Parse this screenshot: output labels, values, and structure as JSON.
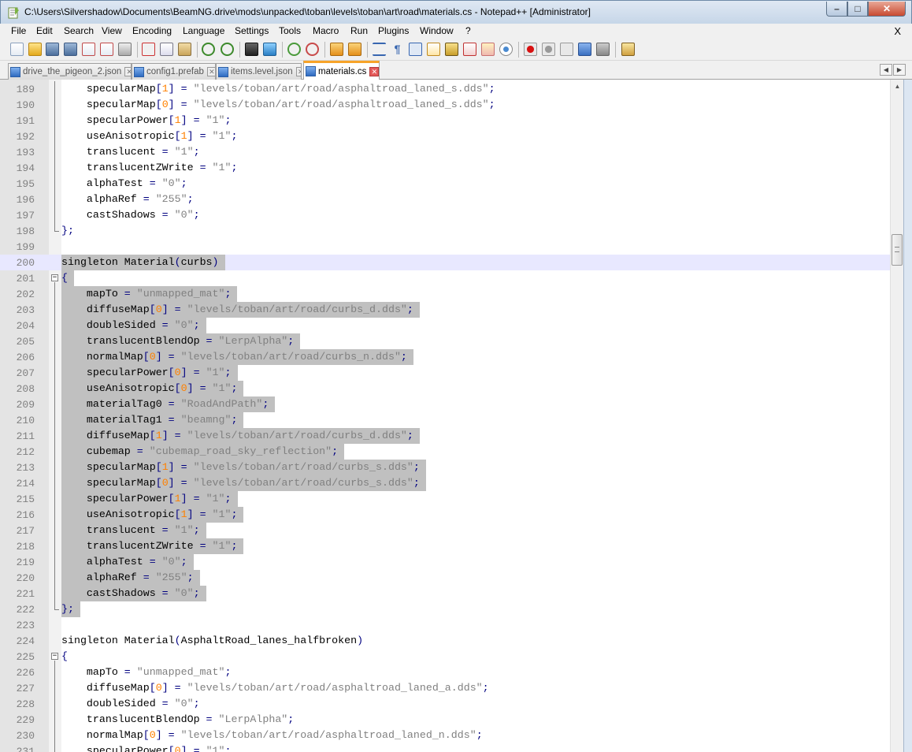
{
  "window": {
    "title": "C:\\Users\\Silvershadow\\Documents\\BeamNG.drive\\mods\\unpacked\\toban\\levels\\toban\\art\\road\\materials.cs - Notepad++ [Administrator]",
    "minimize": "–",
    "maximize": "□",
    "close": "✕"
  },
  "menu": {
    "items": [
      "File",
      "Edit",
      "Search",
      "View",
      "Encoding",
      "Language",
      "Settings",
      "Tools",
      "Macro",
      "Run",
      "Plugins",
      "Window",
      "?"
    ],
    "close_x": "X"
  },
  "toolbar": {
    "icons": [
      "new-file-icon",
      "open-file-icon",
      "save-icon",
      "save-all-icon",
      "close-icon",
      "close-all-icon",
      "print-icon",
      "cut-icon",
      "copy-icon",
      "paste-icon",
      "undo-icon",
      "redo-icon",
      "find-icon",
      "replace-icon",
      "zoom-in-icon",
      "zoom-out-icon",
      "sync-vertical-icon",
      "sync-horizontal-icon",
      "word-wrap-icon",
      "show-all-chars-icon",
      "indent-guide-icon",
      "user-language-icon",
      "doc-map-icon",
      "function-list-icon",
      "folder-as-workspace-icon",
      "monitoring-icon",
      "record-macro-icon",
      "stop-macro-icon",
      "play-macro-icon",
      "run-macro-multiple-icon",
      "save-macro-icon",
      "launch-browser-icon"
    ]
  },
  "tabs": [
    {
      "label": "drive_the_pigeon_2.json",
      "active": false
    },
    {
      "label": "config1.prefab",
      "active": false
    },
    {
      "label": "items.level.json",
      "active": false
    },
    {
      "label": "materials.cs",
      "active": true
    }
  ],
  "editor": {
    "current_line": 200,
    "selection_start": 201,
    "selection_end": 222,
    "lines": [
      {
        "n": "189",
        "text": "    specularMap[1] = \"levels/toban/art/road/asphaltroad_laned_s.dds\";"
      },
      {
        "n": "190",
        "text": "    specularMap[0] = \"levels/toban/art/road/asphaltroad_laned_s.dds\";"
      },
      {
        "n": "191",
        "text": "    specularPower[1] = \"1\";"
      },
      {
        "n": "192",
        "text": "    useAnisotropic[1] = \"1\";"
      },
      {
        "n": "193",
        "text": "    translucent = \"1\";"
      },
      {
        "n": "194",
        "text": "    translucentZWrite = \"1\";"
      },
      {
        "n": "195",
        "text": "    alphaTest = \"0\";"
      },
      {
        "n": "196",
        "text": "    alphaRef = \"255\";"
      },
      {
        "n": "197",
        "text": "    castShadows = \"0\";"
      },
      {
        "n": "198",
        "text": "};"
      },
      {
        "n": "199",
        "text": ""
      },
      {
        "n": "200",
        "text": "singleton Material(curbs)"
      },
      {
        "n": "201",
        "text": "{"
      },
      {
        "n": "202",
        "text": "    mapTo = \"unmapped_mat\";"
      },
      {
        "n": "203",
        "text": "    diffuseMap[0] = \"levels/toban/art/road/curbs_d.dds\";"
      },
      {
        "n": "204",
        "text": "    doubleSided = \"0\";"
      },
      {
        "n": "205",
        "text": "    translucentBlendOp = \"LerpAlpha\";"
      },
      {
        "n": "206",
        "text": "    normalMap[0] = \"levels/toban/art/road/curbs_n.dds\";"
      },
      {
        "n": "207",
        "text": "    specularPower[0] = \"1\";"
      },
      {
        "n": "208",
        "text": "    useAnisotropic[0] = \"1\";"
      },
      {
        "n": "209",
        "text": "    materialTag0 = \"RoadAndPath\";"
      },
      {
        "n": "210",
        "text": "    materialTag1 = \"beamng\";"
      },
      {
        "n": "211",
        "text": "    diffuseMap[1] = \"levels/toban/art/road/curbs_d.dds\";"
      },
      {
        "n": "212",
        "text": "    cubemap = \"cubemap_road_sky_reflection\";"
      },
      {
        "n": "213",
        "text": "    specularMap[1] = \"levels/toban/art/road/curbs_s.dds\";"
      },
      {
        "n": "214",
        "text": "    specularMap[0] = \"levels/toban/art/road/curbs_s.dds\";"
      },
      {
        "n": "215",
        "text": "    specularPower[1] = \"1\";"
      },
      {
        "n": "216",
        "text": "    useAnisotropic[1] = \"1\";"
      },
      {
        "n": "217",
        "text": "    translucent = \"1\";"
      },
      {
        "n": "218",
        "text": "    translucentZWrite = \"1\";"
      },
      {
        "n": "219",
        "text": "    alphaTest = \"0\";"
      },
      {
        "n": "220",
        "text": "    alphaRef = \"255\";"
      },
      {
        "n": "221",
        "text": "    castShadows = \"0\";"
      },
      {
        "n": "222",
        "text": "};"
      },
      {
        "n": "223",
        "text": ""
      },
      {
        "n": "224",
        "text": "singleton Material(AsphaltRoad_lanes_halfbroken)"
      },
      {
        "n": "225",
        "text": "{"
      },
      {
        "n": "226",
        "text": "    mapTo = \"unmapped_mat\";"
      },
      {
        "n": "227",
        "text": "    diffuseMap[0] = \"levels/toban/art/road/asphaltroad_laned_a.dds\";"
      },
      {
        "n": "228",
        "text": "    doubleSided = \"0\";"
      },
      {
        "n": "229",
        "text": "    translucentBlendOp = \"LerpAlpha\";"
      },
      {
        "n": "230",
        "text": "    normalMap[0] = \"levels/toban/art/road/asphaltroad_laned_n.dds\";"
      },
      {
        "n": "231",
        "text": "    specularPower[0] = \"1\";"
      }
    ]
  },
  "colors": {
    "operator": "#000080",
    "number": "#ff8000",
    "string": "#808080",
    "selection": "#c0c0c0",
    "current_line": "#e8e8ff",
    "active_tab_accent": "#f7a42a"
  }
}
